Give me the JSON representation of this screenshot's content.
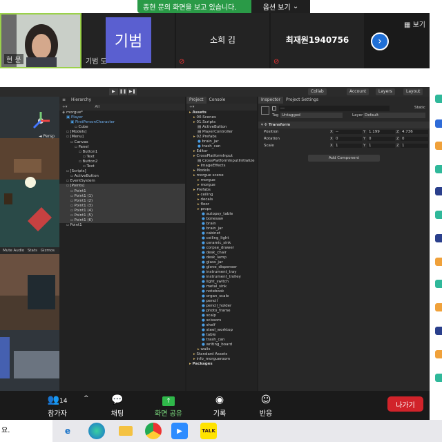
{
  "zoom": {
    "share_banner": "종현 문의 화면을 보고 있습니다.",
    "options_label": "옵션 보기",
    "gallery_view_label": "보기",
    "tiles": [
      {
        "name": "현 문"
      },
      {
        "name": "기범 도",
        "avatar": "기범"
      },
      {
        "name": "소희 김"
      },
      {
        "name": "최재원1940756"
      }
    ],
    "controls": {
      "participants_label": "참가자",
      "participants_count": "14",
      "chat_label": "채팅",
      "share_label": "화면 공유",
      "record_label": "기록",
      "reactions_label": "반응",
      "leave_label": "나가기"
    }
  },
  "unity": {
    "top_buttons": {
      "collab": "Collab",
      "account": "Account",
      "layers": "Layers",
      "layout": "Layout"
    },
    "scene": {
      "persp": "◄ Persp",
      "toolbar_items": [
        "Mute Audio",
        "Stats",
        "Gizmos"
      ]
    },
    "hierarchy": {
      "title": "Hierarchy",
      "search": "All",
      "items": [
        {
          "label": "morgue*",
          "indent": 0,
          "type": "scene"
        },
        {
          "label": "Player",
          "indent": 1,
          "type": "blue"
        },
        {
          "label": "FirstPersonCharacter",
          "indent": 2,
          "type": "blue"
        },
        {
          "label": "Cube",
          "indent": 3
        },
        {
          "label": "[Models]",
          "indent": 1
        },
        {
          "label": "[Menu]",
          "indent": 1
        },
        {
          "label": "Canvas",
          "indent": 2
        },
        {
          "label": "Panel",
          "indent": 3
        },
        {
          "label": "Button1",
          "indent": 4
        },
        {
          "label": "Text",
          "indent": 5
        },
        {
          "label": "Button2",
          "indent": 4
        },
        {
          "label": "Text",
          "indent": 5
        },
        {
          "label": "[Scripts]",
          "indent": 1
        },
        {
          "label": "ActiveButton",
          "indent": 2
        },
        {
          "label": "EventSystem",
          "indent": 1
        },
        {
          "label": "[Points]",
          "indent": 1,
          "selected": true
        },
        {
          "label": "Point1",
          "indent": 2,
          "selected": true
        },
        {
          "label": "Point1 (1)",
          "indent": 2,
          "selected": true
        },
        {
          "label": "Point1 (2)",
          "indent": 2,
          "selected": true
        },
        {
          "label": "Point1 (3)",
          "indent": 2,
          "selected": true
        },
        {
          "label": "Point1 (4)",
          "indent": 2,
          "selected": true
        },
        {
          "label": "Point1 (5)",
          "indent": 2,
          "selected": true
        },
        {
          "label": "Point1 (6)",
          "indent": 2,
          "selected": true
        },
        {
          "label": "Point1",
          "indent": 1
        }
      ]
    },
    "project": {
      "tab_project": "Project",
      "tab_console": "Console",
      "items": [
        {
          "label": "Assets",
          "indent": 0,
          "bold": true
        },
        {
          "label": "00.Scenes",
          "indent": 1
        },
        {
          "label": "01.Scripts",
          "indent": 1
        },
        {
          "label": "ActiveButton",
          "indent": 2,
          "type": "script"
        },
        {
          "label": "PlayerController",
          "indent": 2,
          "type": "script"
        },
        {
          "label": "02.Prefabs",
          "indent": 1
        },
        {
          "label": "brain_jar",
          "indent": 2,
          "type": "prefab"
        },
        {
          "label": "trash_can",
          "indent": 2,
          "type": "prefab"
        },
        {
          "label": "Editor",
          "indent": 1
        },
        {
          "label": "CrossPlatformInput",
          "indent": 1
        },
        {
          "label": "CrossPlatformInputInitialize",
          "indent": 2,
          "type": "script"
        },
        {
          "label": "ImageEffects",
          "indent": 2
        },
        {
          "label": "Models",
          "indent": 1
        },
        {
          "label": "morgue scene",
          "indent": 1
        },
        {
          "label": "morgue",
          "indent": 2
        },
        {
          "label": "morgue",
          "indent": 2
        },
        {
          "label": "Prefabs",
          "indent": 1
        },
        {
          "label": "ceiling",
          "indent": 2
        },
        {
          "label": "decals",
          "indent": 2
        },
        {
          "label": "floor",
          "indent": 2
        },
        {
          "label": "props",
          "indent": 2
        },
        {
          "label": "autopsy_table",
          "indent": 3,
          "type": "prefab"
        },
        {
          "label": "bonesaw",
          "indent": 3,
          "type": "prefab"
        },
        {
          "label": "brain",
          "indent": 3,
          "type": "prefab"
        },
        {
          "label": "brain_jar",
          "indent": 3,
          "type": "prefab"
        },
        {
          "label": "cabinet",
          "indent": 3,
          "type": "prefab"
        },
        {
          "label": "ceiling_light",
          "indent": 3,
          "type": "prefab"
        },
        {
          "label": "ceramic_sink",
          "indent": 3,
          "type": "prefab"
        },
        {
          "label": "corpse_drawer",
          "indent": 3,
          "type": "prefab"
        },
        {
          "label": "desk_chair",
          "indent": 3,
          "type": "prefab"
        },
        {
          "label": "desk_lamp",
          "indent": 3,
          "type": "prefab"
        },
        {
          "label": "glass_jar",
          "indent": 3,
          "type": "prefab"
        },
        {
          "label": "glove_dispenser",
          "indent": 3,
          "type": "prefab"
        },
        {
          "label": "instrument_tray",
          "indent": 3,
          "type": "prefab"
        },
        {
          "label": "instrument_trolley",
          "indent": 3,
          "type": "prefab"
        },
        {
          "label": "light_switch",
          "indent": 3,
          "type": "prefab"
        },
        {
          "label": "metal_sink",
          "indent": 3,
          "type": "prefab"
        },
        {
          "label": "notebook",
          "indent": 3,
          "type": "prefab"
        },
        {
          "label": "organ_scale",
          "indent": 3,
          "type": "prefab"
        },
        {
          "label": "pencil",
          "indent": 3,
          "type": "prefab"
        },
        {
          "label": "pencil_holder",
          "indent": 3,
          "type": "prefab"
        },
        {
          "label": "photo_frame",
          "indent": 3,
          "type": "prefab"
        },
        {
          "label": "scalp",
          "indent": 3,
          "type": "prefab"
        },
        {
          "label": "scissors",
          "indent": 3,
          "type": "prefab"
        },
        {
          "label": "shelf",
          "indent": 3,
          "type": "prefab"
        },
        {
          "label": "steel_worktop",
          "indent": 3,
          "type": "prefab"
        },
        {
          "label": "table",
          "indent": 3,
          "type": "prefab"
        },
        {
          "label": "trash_can",
          "indent": 3,
          "type": "prefab"
        },
        {
          "label": "writing_board",
          "indent": 3,
          "type": "prefab"
        },
        {
          "label": "walls",
          "indent": 2
        },
        {
          "label": "Standard Assets",
          "indent": 1
        },
        {
          "label": "info_morgueroom",
          "indent": 1
        },
        {
          "label": "Packages",
          "indent": 0,
          "bold": true
        }
      ]
    },
    "inspector": {
      "tab_inspector": "Inspector",
      "tab_settings": "Project Settings",
      "name_value": "---",
      "static_label": "Static",
      "tag_label": "Tag",
      "tag_value": "Untagged",
      "layer_label": "Layer",
      "layer_value": "Default",
      "transform_label": "Transform",
      "rows": [
        {
          "label": "Position",
          "x": "--",
          "y": "1.199",
          "z": "4.736"
        },
        {
          "label": "Rotation",
          "x": "0",
          "y": "0",
          "z": "0"
        },
        {
          "label": "Scale",
          "x": "1",
          "y": "1",
          "z": "1"
        }
      ],
      "add_component": "Add Component"
    }
  },
  "taskbar": {
    "search_fragment": "요."
  }
}
